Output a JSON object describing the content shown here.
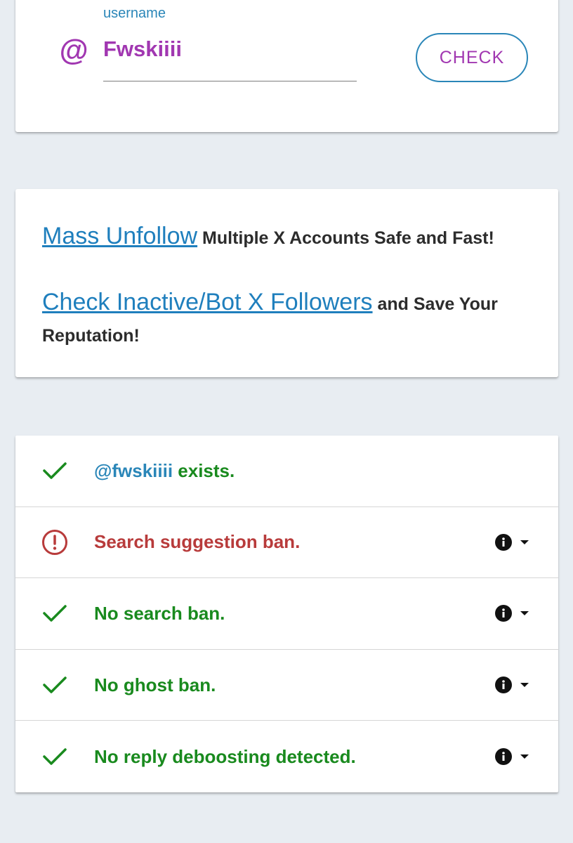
{
  "search": {
    "label": "username",
    "value": "Fwskiiii",
    "at_symbol": "@",
    "check_label": "CHECK"
  },
  "promo": {
    "line1_link": "Mass Unfollow",
    "line1_text": " Multiple X Accounts Safe and Fast!",
    "line2_link": "Check Inactive/Bot X Followers",
    "line2_text": " and Save Your Reputation!"
  },
  "results": {
    "exists": {
      "handle": "@fwskiiii",
      "text": " exists.",
      "status": "ok"
    },
    "items": [
      {
        "text": "Search suggestion ban.",
        "status": "warning"
      },
      {
        "text": "No search ban.",
        "status": "ok"
      },
      {
        "text": "No ghost ban.",
        "status": "ok"
      },
      {
        "text": "No reply deboosting detected.",
        "status": "ok"
      }
    ]
  },
  "colors": {
    "accent_blue": "#2a86b8",
    "accent_purple": "#a137b1",
    "ok_green": "#198a1e",
    "warn_red": "#b83b3b",
    "background": "#e8edf2"
  },
  "icons": {
    "ok": "check-icon",
    "warning": "exclamation-circle-icon",
    "info": "info-icon",
    "dropdown": "caret-down-icon"
  }
}
